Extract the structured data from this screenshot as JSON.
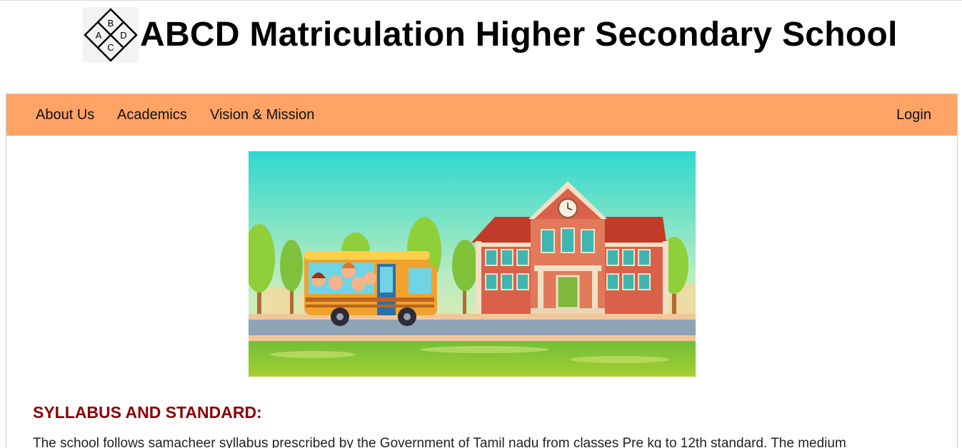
{
  "header": {
    "logo_letters": [
      "B",
      "A",
      "D",
      "C"
    ],
    "school_name": "ABCD Matriculation Higher Secondary School"
  },
  "nav": {
    "items": [
      {
        "label": "About Us"
      },
      {
        "label": "Academics"
      },
      {
        "label": "Vision & Mission"
      }
    ],
    "login_label": "Login",
    "bar_color": "#ffa366"
  },
  "hero": {
    "description": "cartoon school building with school bus"
  },
  "section": {
    "title": "SYLLABUS AND STANDARD:",
    "title_color": "#8b0000",
    "body": "The school follows samacheer syllabus prescribed by the Government of Tamil nadu from classes Pre kg to 12th standard.  The medium"
  }
}
